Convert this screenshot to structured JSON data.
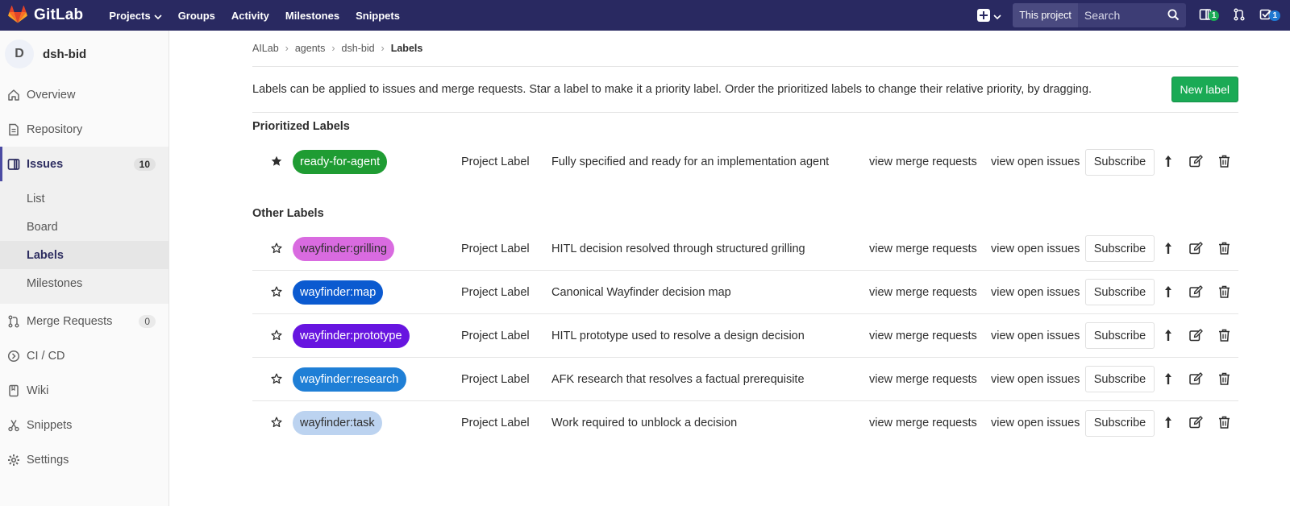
{
  "navbar": {
    "brand": "GitLab",
    "links": [
      {
        "label": "Projects",
        "has_caret": true
      },
      {
        "label": "Groups"
      },
      {
        "label": "Activity"
      },
      {
        "label": "Milestones"
      },
      {
        "label": "Snippets"
      }
    ],
    "search_scope": "This project",
    "search_placeholder": "Search",
    "issues_badge": "1",
    "todos_badge": "1"
  },
  "sidebar": {
    "avatar_letter": "D",
    "project_name": "dsh-bid",
    "items": [
      {
        "label": "Overview",
        "icon": "home-icon"
      },
      {
        "label": "Repository",
        "icon": "doc-icon"
      },
      {
        "label": "Issues",
        "icon": "issues-icon",
        "count": "10",
        "active": true
      },
      {
        "label": "Merge Requests",
        "icon": "merge-icon",
        "count": "0"
      },
      {
        "label": "CI / CD",
        "icon": "rocket-icon"
      },
      {
        "label": "Wiki",
        "icon": "book-icon"
      },
      {
        "label": "Snippets",
        "icon": "scissors-icon"
      },
      {
        "label": "Settings",
        "icon": "gear-icon"
      }
    ],
    "issues_sub": [
      "List",
      "Board",
      "Labels",
      "Milestones"
    ],
    "issues_sub_active": "Labels"
  },
  "breadcrumb": [
    "AILab",
    "agents",
    "dsh-bid",
    "Labels"
  ],
  "info_text": "Labels can be applied to issues and merge requests. Star a label to make it a priority label. Order the prioritized labels to change their relative priority, by dragging.",
  "new_label": "New label",
  "prioritized_title": "Prioritized Labels",
  "other_title": "Other Labels",
  "row_texts": {
    "type": "Project Label",
    "view_mrs": "view merge requests",
    "view_issues": "view open issues",
    "subscribe": "Subscribe"
  },
  "prioritized": [
    {
      "name": "ready-for-agent",
      "color": "#1f9c33",
      "text_color": "#ffffff",
      "description": "Fully specified and ready for an implementation agent",
      "starred": true
    }
  ],
  "others": [
    {
      "name": "wayfinder:grilling",
      "color": "#d96be0",
      "text_color": "#2e2e2e",
      "description": "HITL decision resolved through structured grilling",
      "starred": false
    },
    {
      "name": "wayfinder:map",
      "color": "#0b5ad0",
      "text_color": "#ffffff",
      "description": "Canonical Wayfinder decision map",
      "starred": false
    },
    {
      "name": "wayfinder:prototype",
      "color": "#6715e0",
      "text_color": "#ffffff",
      "description": "HITL prototype used to resolve a design decision",
      "starred": false
    },
    {
      "name": "wayfinder:research",
      "color": "#1f7fd6",
      "text_color": "#ffffff",
      "description": "AFK research that resolves a factual prerequisite",
      "starred": false
    },
    {
      "name": "wayfinder:task",
      "color": "#bcd3f0",
      "text_color": "#2e2e2e",
      "description": "Work required to unblock a decision",
      "starred": false
    }
  ]
}
